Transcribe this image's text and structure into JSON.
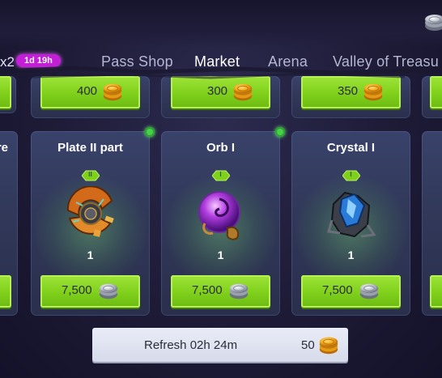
{
  "tabs": {
    "partial_prefix": "x2",
    "timer": "1d 19h",
    "items": [
      {
        "label": "Pass Shop",
        "active": false
      },
      {
        "label": "Market",
        "active": true
      },
      {
        "label": "Arena",
        "active": false
      },
      {
        "label": "Valley of Treasu",
        "active": false
      }
    ]
  },
  "top_row": {
    "prices": [
      "400",
      "300",
      "350"
    ],
    "currency_icon": "gold-coin-icon"
  },
  "cards": [
    {
      "partial_title": "re"
    },
    {
      "title": "Plate II part",
      "tier": "II",
      "quantity": "1",
      "price": "7,500",
      "currency_icon": "silver-coin-icon",
      "item_icon": "plate-part-icon"
    },
    {
      "title": "Orb I",
      "tier": "I",
      "quantity": "1",
      "price": "7,500",
      "currency_icon": "silver-coin-icon",
      "item_icon": "purple-orb-icon"
    },
    {
      "title": "Crystal I",
      "tier": "I",
      "quantity": "1",
      "price": "7,500",
      "currency_icon": "silver-coin-icon",
      "item_icon": "blue-crystal-icon"
    }
  ],
  "refresh": {
    "label": "Refresh 02h 24m",
    "cost": "50",
    "currency_icon": "gold-coin-icon"
  },
  "colors": {
    "accent_green": "#7fd01b",
    "timer_magenta": "#c21fd6",
    "card_bg": "#313859",
    "new_dot": "#47d04a"
  }
}
